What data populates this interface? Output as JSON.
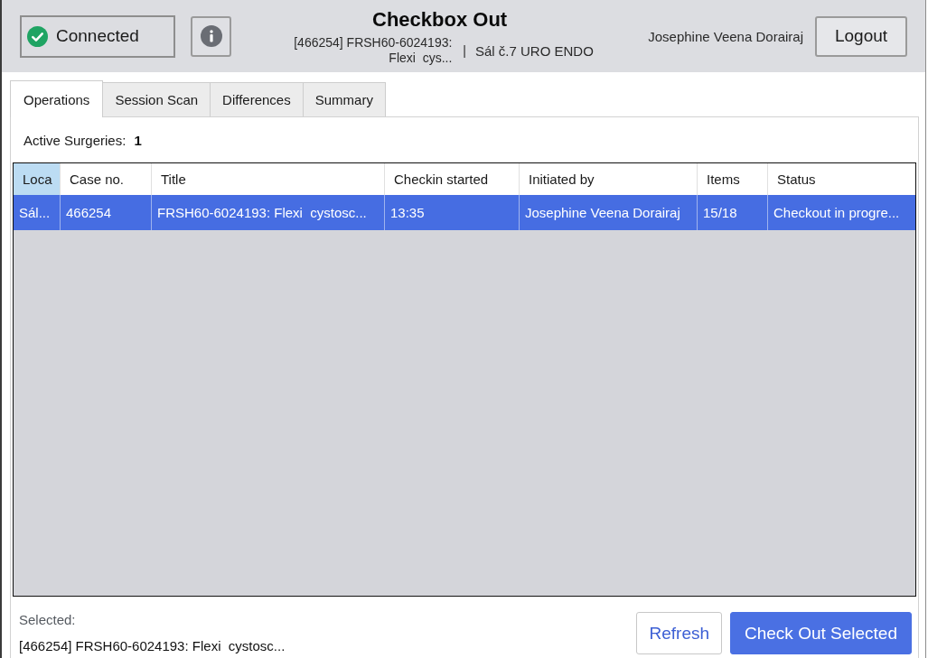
{
  "header": {
    "connection": {
      "label": "Connected",
      "connected": true
    },
    "title": "Checkbox Out",
    "case_label": "[466254] FRSH60-6024193: Flexi  cys...",
    "separator": "|",
    "room": "Sál č.7 URO ENDO",
    "user": "Josephine Veena Dorairaj",
    "logout_button": "Logout"
  },
  "tabs": [
    {
      "label": "Operations",
      "selected": true
    },
    {
      "label": "Session Scan",
      "selected": false
    },
    {
      "label": "Differences",
      "selected": false
    },
    {
      "label": "Summary",
      "selected": false
    }
  ],
  "active_surgeries": {
    "label": "Active Surgeries:",
    "count": "1"
  },
  "table": {
    "columns": [
      {
        "label": "Loca",
        "selected": true
      },
      {
        "label": "Case no.",
        "selected": false
      },
      {
        "label": "Title",
        "selected": false
      },
      {
        "label": "Checkin started",
        "selected": false
      },
      {
        "label": "Initiated by",
        "selected": false
      },
      {
        "label": "Items",
        "selected": false
      },
      {
        "label": "Status",
        "selected": false
      }
    ],
    "rows": [
      {
        "selected": true,
        "cells": [
          "Sál...",
          "466254",
          "FRSH60-6024193: Flexi  cystosc...",
          "13:35",
          "Josephine Veena Dorairaj",
          "15/18",
          "Checkout in progre..."
        ]
      }
    ]
  },
  "selection": {
    "label": "Selected:",
    "value": "[466254] FRSH60-6024193: Flexi  cystosc..."
  },
  "buttons": [
    {
      "label": "Refresh",
      "kind": "secondary"
    },
    {
      "label": "Check Out Selected",
      "kind": "primary"
    }
  ]
}
